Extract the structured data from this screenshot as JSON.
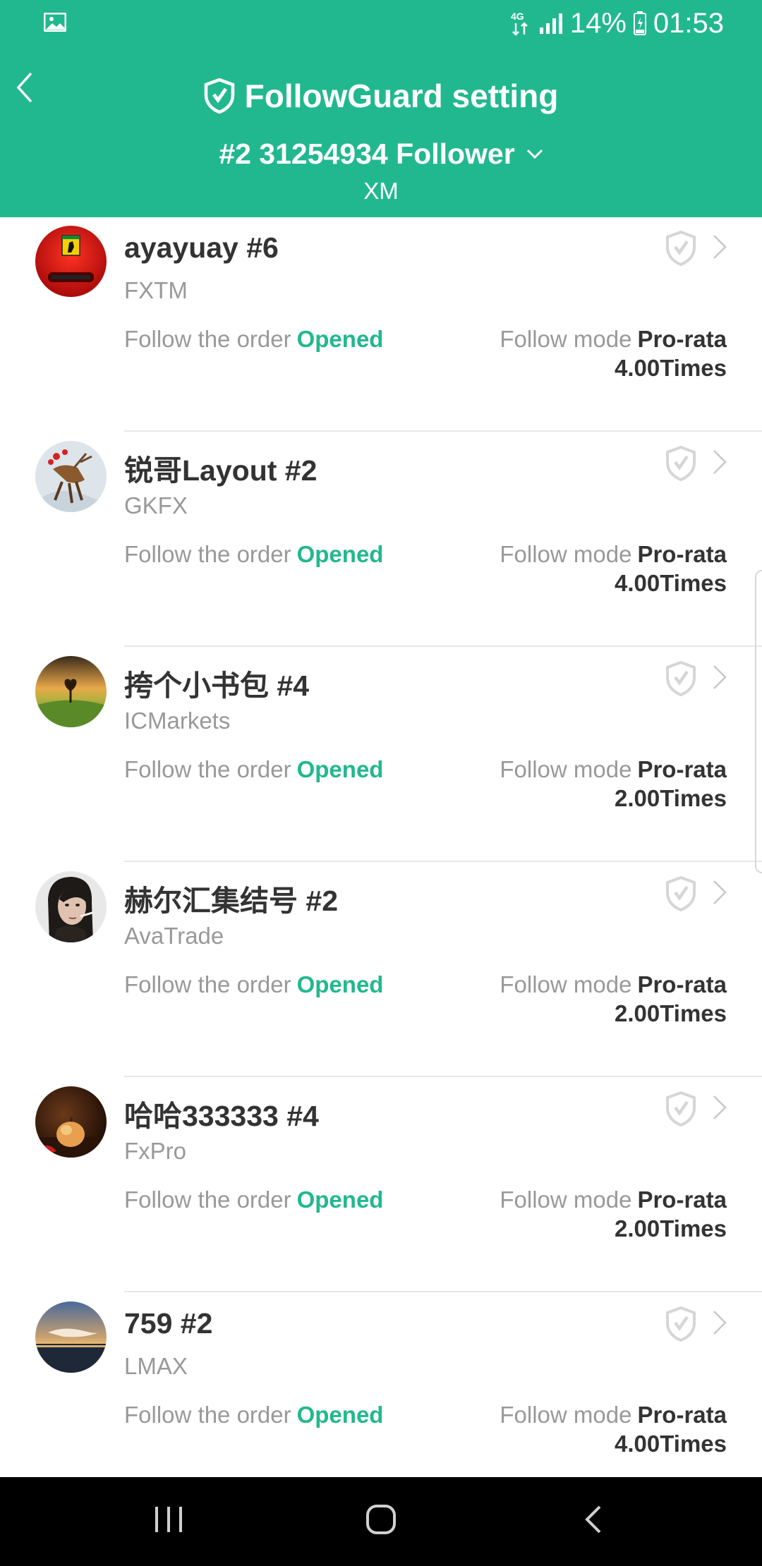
{
  "status_bar": {
    "network": "4G",
    "battery": "14%",
    "time": "01:53"
  },
  "header": {
    "title": "FollowGuard setting",
    "account": "#2 31254934 Follower",
    "broker": "XM"
  },
  "items": [
    {
      "name": "ayayuay #6",
      "broker": "FXTM",
      "order_label": "Follow the order",
      "order_status": "Opened",
      "mode_label": "Follow mode",
      "mode_value": "Pro-rata",
      "multiplier": "4.00Times",
      "avatar": "ferrari-logo"
    },
    {
      "name": "锐哥Layout #2",
      "broker": "GKFX",
      "order_label": "Follow the order",
      "order_status": "Opened",
      "mode_label": "Follow mode",
      "mode_value": "Pro-rata",
      "multiplier": "4.00Times",
      "avatar": "deer"
    },
    {
      "name": "挎个小书包 #4",
      "broker": "ICMarkets",
      "order_label": "Follow the order",
      "order_status": "Opened",
      "mode_label": "Follow mode",
      "mode_value": "Pro-rata",
      "multiplier": "2.00Times",
      "avatar": "heart-tree"
    },
    {
      "name": "赫尔汇集结号 #2",
      "broker": "AvaTrade",
      "order_label": "Follow the order",
      "order_status": "Opened",
      "mode_label": "Follow mode",
      "mode_value": "Pro-rata",
      "multiplier": "2.00Times",
      "avatar": "woman-portrait"
    },
    {
      "name": "哈哈333333 #4",
      "broker": "FxPro",
      "order_label": "Follow the order",
      "order_status": "Opened",
      "mode_label": "Follow mode",
      "mode_value": "Pro-rata",
      "multiplier": "2.00Times",
      "avatar": "peach"
    },
    {
      "name": "759 #2",
      "broker": "LMAX",
      "order_label": "Follow the order",
      "order_status": "Opened",
      "mode_label": "Follow mode",
      "mode_value": "Pro-rata",
      "multiplier": "4.00Times",
      "avatar": "sunset-sea"
    }
  ],
  "colors": {
    "accent": "#22b88f",
    "text_primary": "#333333",
    "text_secondary": "#999999"
  }
}
